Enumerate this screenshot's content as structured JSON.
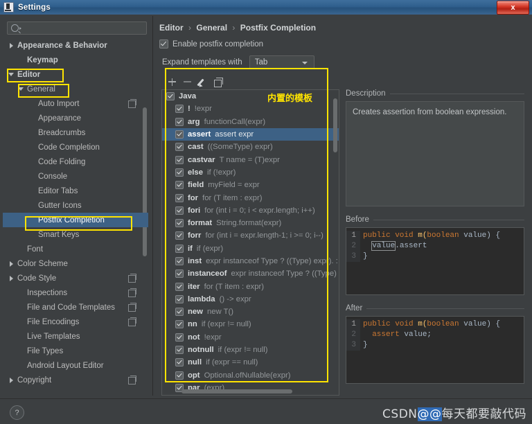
{
  "window": {
    "title": "Settings",
    "close_label": "x",
    "icon": "settings-window-icon"
  },
  "sidebar": {
    "search": {
      "placeholder": "",
      "value": "",
      "icon": "search-icon"
    },
    "items": [
      {
        "label": "Appearance & Behavior",
        "indent": 1,
        "arrow": "right",
        "bold": true,
        "selected": false,
        "copy": false
      },
      {
        "label": "Keymap",
        "indent": 2,
        "arrow": "none",
        "bold": true,
        "selected": false,
        "copy": false
      },
      {
        "label": "Editor",
        "indent": 1,
        "arrow": "down",
        "bold": true,
        "selected": false,
        "copy": false
      },
      {
        "label": "General",
        "indent": 2,
        "arrow": "down",
        "bold": false,
        "selected": false,
        "copy": false
      },
      {
        "label": "Auto Import",
        "indent": 3,
        "arrow": "none",
        "bold": false,
        "selected": false,
        "copy": true
      },
      {
        "label": "Appearance",
        "indent": 3,
        "arrow": "none",
        "bold": false,
        "selected": false,
        "copy": false
      },
      {
        "label": "Breadcrumbs",
        "indent": 3,
        "arrow": "none",
        "bold": false,
        "selected": false,
        "copy": false
      },
      {
        "label": "Code Completion",
        "indent": 3,
        "arrow": "none",
        "bold": false,
        "selected": false,
        "copy": false
      },
      {
        "label": "Code Folding",
        "indent": 3,
        "arrow": "none",
        "bold": false,
        "selected": false,
        "copy": false
      },
      {
        "label": "Console",
        "indent": 3,
        "arrow": "none",
        "bold": false,
        "selected": false,
        "copy": false
      },
      {
        "label": "Editor Tabs",
        "indent": 3,
        "arrow": "none",
        "bold": false,
        "selected": false,
        "copy": false
      },
      {
        "label": "Gutter Icons",
        "indent": 3,
        "arrow": "none",
        "bold": false,
        "selected": false,
        "copy": false
      },
      {
        "label": "Postfix Completion",
        "indent": 3,
        "arrow": "none",
        "bold": false,
        "selected": true,
        "copy": false
      },
      {
        "label": "Smart Keys",
        "indent": 3,
        "arrow": "none",
        "bold": false,
        "selected": false,
        "copy": false
      },
      {
        "label": "Font",
        "indent": 2,
        "arrow": "none",
        "bold": false,
        "selected": false,
        "copy": false
      },
      {
        "label": "Color Scheme",
        "indent": 1,
        "arrow": "right",
        "bold": false,
        "selected": false,
        "copy": false
      },
      {
        "label": "Code Style",
        "indent": 1,
        "arrow": "right",
        "bold": false,
        "selected": false,
        "copy": true
      },
      {
        "label": "Inspections",
        "indent": 2,
        "arrow": "none",
        "bold": false,
        "selected": false,
        "copy": true
      },
      {
        "label": "File and Code Templates",
        "indent": 2,
        "arrow": "none",
        "bold": false,
        "selected": false,
        "copy": true
      },
      {
        "label": "File Encodings",
        "indent": 2,
        "arrow": "none",
        "bold": false,
        "selected": false,
        "copy": true
      },
      {
        "label": "Live Templates",
        "indent": 2,
        "arrow": "none",
        "bold": false,
        "selected": false,
        "copy": false
      },
      {
        "label": "File Types",
        "indent": 2,
        "arrow": "none",
        "bold": false,
        "selected": false,
        "copy": false
      },
      {
        "label": "Android Layout Editor",
        "indent": 2,
        "arrow": "none",
        "bold": false,
        "selected": false,
        "copy": false
      },
      {
        "label": "Copyright",
        "indent": 1,
        "arrow": "right",
        "bold": false,
        "selected": false,
        "copy": true
      }
    ]
  },
  "main": {
    "breadcrumb": {
      "part1": "Editor",
      "part2": "General",
      "part3": "Postfix Completion",
      "separator": "›"
    },
    "enable_checkbox": {
      "label": "Enable postfix completion",
      "checked": true
    },
    "expand": {
      "label": "Expand templates with",
      "value": "Tab"
    },
    "toolbar": {
      "add": "add-icon",
      "remove": "remove-icon",
      "edit": "edit-pencil-icon",
      "duplicate": "duplicate-icon"
    },
    "templates": [
      {
        "key": "Java",
        "desc": "",
        "root": true,
        "checked": true,
        "selected": false
      },
      {
        "key": "!",
        "desc": "!expr",
        "root": false,
        "checked": true,
        "selected": false
      },
      {
        "key": "arg",
        "desc": "functionCall(expr)",
        "root": false,
        "checked": true,
        "selected": false
      },
      {
        "key": "assert",
        "desc": "assert expr",
        "root": false,
        "checked": true,
        "selected": true
      },
      {
        "key": "cast",
        "desc": "((SomeType) expr)",
        "root": false,
        "checked": true,
        "selected": false
      },
      {
        "key": "castvar",
        "desc": "T name = (T)expr",
        "root": false,
        "checked": true,
        "selected": false
      },
      {
        "key": "else",
        "desc": "if (!expr)",
        "root": false,
        "checked": true,
        "selected": false
      },
      {
        "key": "field",
        "desc": "myField = expr",
        "root": false,
        "checked": true,
        "selected": false
      },
      {
        "key": "for",
        "desc": "for (T item : expr)",
        "root": false,
        "checked": true,
        "selected": false
      },
      {
        "key": "fori",
        "desc": "for (int i = 0; i < expr.length; i++)",
        "root": false,
        "checked": true,
        "selected": false
      },
      {
        "key": "format",
        "desc": "String.format(expr)",
        "root": false,
        "checked": true,
        "selected": false
      },
      {
        "key": "forr",
        "desc": "for (int i = expr.length-1; i >= 0; i--)",
        "root": false,
        "checked": true,
        "selected": false
      },
      {
        "key": "if",
        "desc": "if (expr)",
        "root": false,
        "checked": true,
        "selected": false
      },
      {
        "key": "inst",
        "desc": "expr instanceof Type ? ((Type) expr). : null",
        "root": false,
        "checked": true,
        "selected": false
      },
      {
        "key": "instanceof",
        "desc": "expr instanceof Type ? ((Type) expr)",
        "root": false,
        "checked": true,
        "selected": false
      },
      {
        "key": "iter",
        "desc": "for (T item : expr)",
        "root": false,
        "checked": true,
        "selected": false
      },
      {
        "key": "lambda",
        "desc": "() -> expr",
        "root": false,
        "checked": true,
        "selected": false
      },
      {
        "key": "new",
        "desc": "new T()",
        "root": false,
        "checked": true,
        "selected": false
      },
      {
        "key": "nn",
        "desc": "if (expr != null)",
        "root": false,
        "checked": true,
        "selected": false
      },
      {
        "key": "not",
        "desc": "!expr",
        "root": false,
        "checked": true,
        "selected": false
      },
      {
        "key": "notnull",
        "desc": "if (expr != null)",
        "root": false,
        "checked": true,
        "selected": false
      },
      {
        "key": "null",
        "desc": "if (expr == null)",
        "root": false,
        "checked": true,
        "selected": false
      },
      {
        "key": "opt",
        "desc": "Optional.ofNullable(expr)",
        "root": false,
        "checked": true,
        "selected": false
      },
      {
        "key": "par",
        "desc": "(expr)",
        "root": false,
        "checked": true,
        "selected": false
      }
    ],
    "description": {
      "title": "Description",
      "text": "Creates assertion from boolean expression."
    },
    "before": {
      "title": "Before",
      "lines": [
        {
          "num": "1",
          "kw1": "public void ",
          "mid": "m(",
          "kw2": "boolean ",
          "rest": "value) {"
        },
        {
          "num": "2",
          "caret": "value",
          "tail": ".assert"
        },
        {
          "num": "3",
          "text": "}"
        }
      ]
    },
    "after": {
      "title": "After",
      "lines": [
        {
          "num": "1",
          "kw1": "public void ",
          "mid": "m(",
          "kw2": "boolean ",
          "rest": "value) {"
        },
        {
          "num": "2",
          "kw": "assert ",
          "tail": "value;"
        },
        {
          "num": "3",
          "text": "}"
        }
      ]
    }
  },
  "annotations": {
    "builtin_templates_label": "内置的模板",
    "highlight_color": "#ffe400"
  },
  "bottom": {
    "help_label": "?",
    "watermark_prefix": "CSDN",
    "watermark_highlight": "@@",
    "watermark_suffix": "每天都要敲代码"
  }
}
